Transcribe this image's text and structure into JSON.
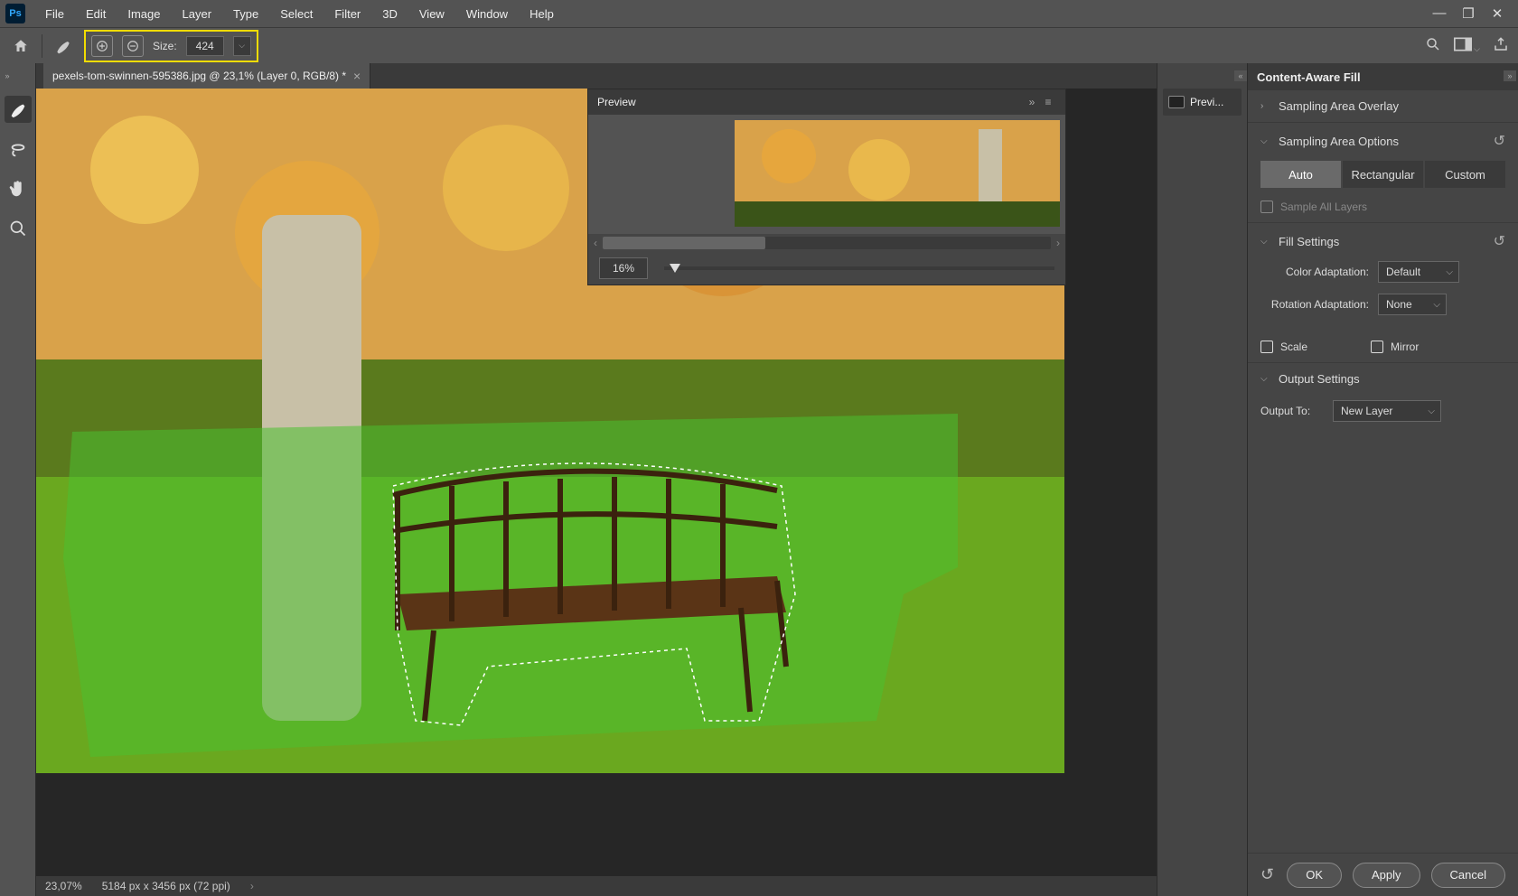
{
  "menu": {
    "logo": "Ps",
    "items": [
      "File",
      "Edit",
      "Image",
      "Layer",
      "Type",
      "Select",
      "Filter",
      "3D",
      "View",
      "Window",
      "Help"
    ]
  },
  "optbar": {
    "size_label": "Size:",
    "size_value": "424"
  },
  "tools": [
    "brush",
    "lasso",
    "hand",
    "zoom"
  ],
  "tab": {
    "title": "pexels-tom-swinnen-595386.jpg @ 23,1% (Layer 0, RGB/8) *"
  },
  "preview": {
    "title": "Preview",
    "zoom": "16%"
  },
  "dock": {
    "label": "Previ..."
  },
  "props": {
    "title": "Content-Aware Fill",
    "sampling_overlay": "Sampling Area Overlay",
    "sampling_options": "Sampling Area Options",
    "seg": [
      "Auto",
      "Rectangular",
      "Custom"
    ],
    "sample_all": "Sample All Layers",
    "fill_settings": "Fill Settings",
    "color_adapt_label": "Color Adaptation:",
    "color_adapt_value": "Default",
    "rot_adapt_label": "Rotation Adaptation:",
    "rot_adapt_value": "None",
    "scale": "Scale",
    "mirror": "Mirror",
    "output_settings": "Output Settings",
    "output_to_label": "Output To:",
    "output_to_value": "New Layer"
  },
  "footer": {
    "ok": "OK",
    "apply": "Apply",
    "cancel": "Cancel"
  },
  "status": {
    "zoom": "23,07%",
    "dims": "5184 px x 3456 px (72 ppi)"
  }
}
